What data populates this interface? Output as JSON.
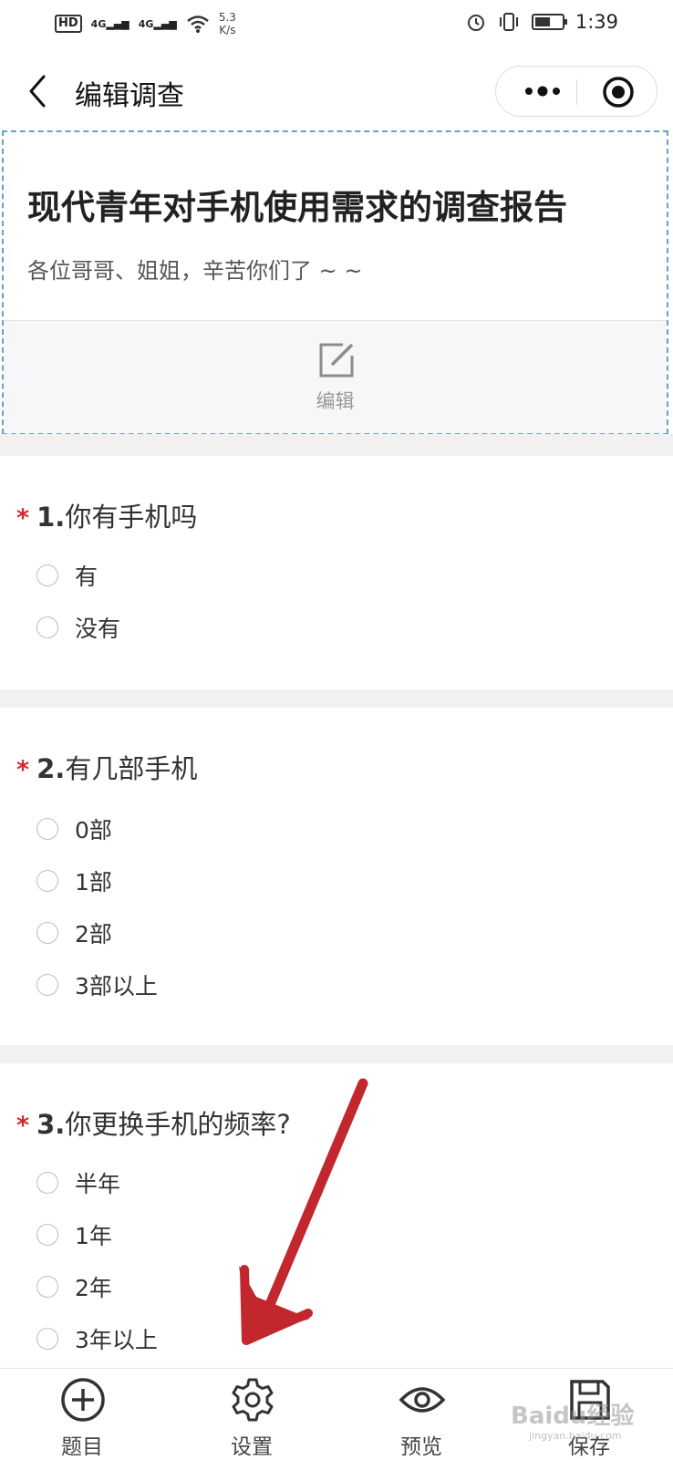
{
  "status_bar": {
    "hd": "HD",
    "signal1": "4G",
    "signal2": "4G",
    "speed_value": "5.3",
    "speed_unit": "K/s",
    "time": "1:39"
  },
  "nav": {
    "title": "编辑调查",
    "back_icon": "chevron-left-icon",
    "more_icon": "more-dots-icon",
    "close_icon": "target-circle-icon"
  },
  "survey": {
    "title": "现代青年对手机使用需求的调查报告",
    "description": "各位哥哥、姐姐，辛苦你们了 ~ ~",
    "edit_label": "编辑"
  },
  "questions": [
    {
      "required_mark": "*",
      "number": "1.",
      "text": "你有手机吗",
      "options": [
        "有",
        "没有"
      ]
    },
    {
      "required_mark": "*",
      "number": "2.",
      "text": "有几部手机",
      "options": [
        "0部",
        "1部",
        "2部",
        "3部以上"
      ]
    },
    {
      "required_mark": "*",
      "number": "3.",
      "text": "你更换手机的频率?",
      "options": [
        "半年",
        "1年",
        "2年",
        "3年以上"
      ]
    }
  ],
  "tab_bar": {
    "items": [
      {
        "label": "题目",
        "icon": "plus-circle-icon"
      },
      {
        "label": "设置",
        "icon": "gear-icon"
      },
      {
        "label": "预览",
        "icon": "eye-icon"
      },
      {
        "label": "保存",
        "icon": "save-icon"
      }
    ]
  },
  "watermark": {
    "text": "Baidu经验",
    "sub": "jingyan.baidu.com"
  },
  "colors": {
    "required": "#d0282e",
    "arrow": "#c1272d",
    "header_border": "#6aa0c8"
  }
}
